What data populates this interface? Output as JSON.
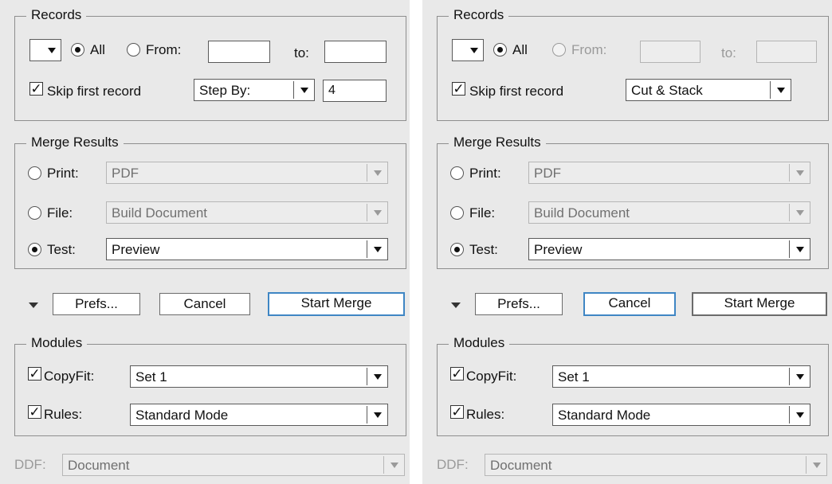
{
  "panels": [
    {
      "records": {
        "legend": "Records",
        "all_label": "All",
        "from_label": "From:",
        "to_label": "to:",
        "from_value": "",
        "to_value": "",
        "skip_label": "Skip first record",
        "skip_checked": true,
        "mode_select": "Step By:",
        "step_value": "4"
      },
      "merge": {
        "legend": "Merge Results",
        "print_label": "Print:",
        "print_value": "PDF",
        "file_label": "File:",
        "file_value": "Build Document",
        "test_label": "Test:",
        "test_value": "Preview"
      },
      "buttons": {
        "prefs": "Prefs...",
        "cancel": "Cancel",
        "start": "Start Merge"
      },
      "modules": {
        "legend": "Modules",
        "copyfit_label": "CopyFit:",
        "copyfit_value": "Set 1",
        "rules_label": "Rules:",
        "rules_value": "Standard Mode"
      },
      "ddf": {
        "label": "DDF:",
        "value": "Document"
      }
    },
    {
      "records": {
        "legend": "Records",
        "all_label": "All",
        "from_label": "From:",
        "to_label": "to:",
        "from_value": "",
        "to_value": "",
        "skip_label": "Skip first record",
        "skip_checked": true,
        "mode_select": "Cut & Stack"
      },
      "merge": {
        "legend": "Merge Results",
        "print_label": "Print:",
        "print_value": "PDF",
        "file_label": "File:",
        "file_value": "Build Document",
        "test_label": "Test:",
        "test_value": "Preview"
      },
      "buttons": {
        "prefs": "Prefs...",
        "cancel": "Cancel",
        "start": "Start Merge"
      },
      "modules": {
        "legend": "Modules",
        "copyfit_label": "CopyFit:",
        "copyfit_value": "Set 1",
        "rules_label": "Rules:",
        "rules_value": "Standard Mode"
      },
      "ddf": {
        "label": "DDF:",
        "value": "Document"
      }
    }
  ],
  "colors": {
    "panel_bg": "#e9e9e9",
    "focus_ring": "#3f86c4"
  },
  "icons": {
    "checkmark": "☑",
    "disclosure": "disclosure-triangle-down-icon"
  }
}
